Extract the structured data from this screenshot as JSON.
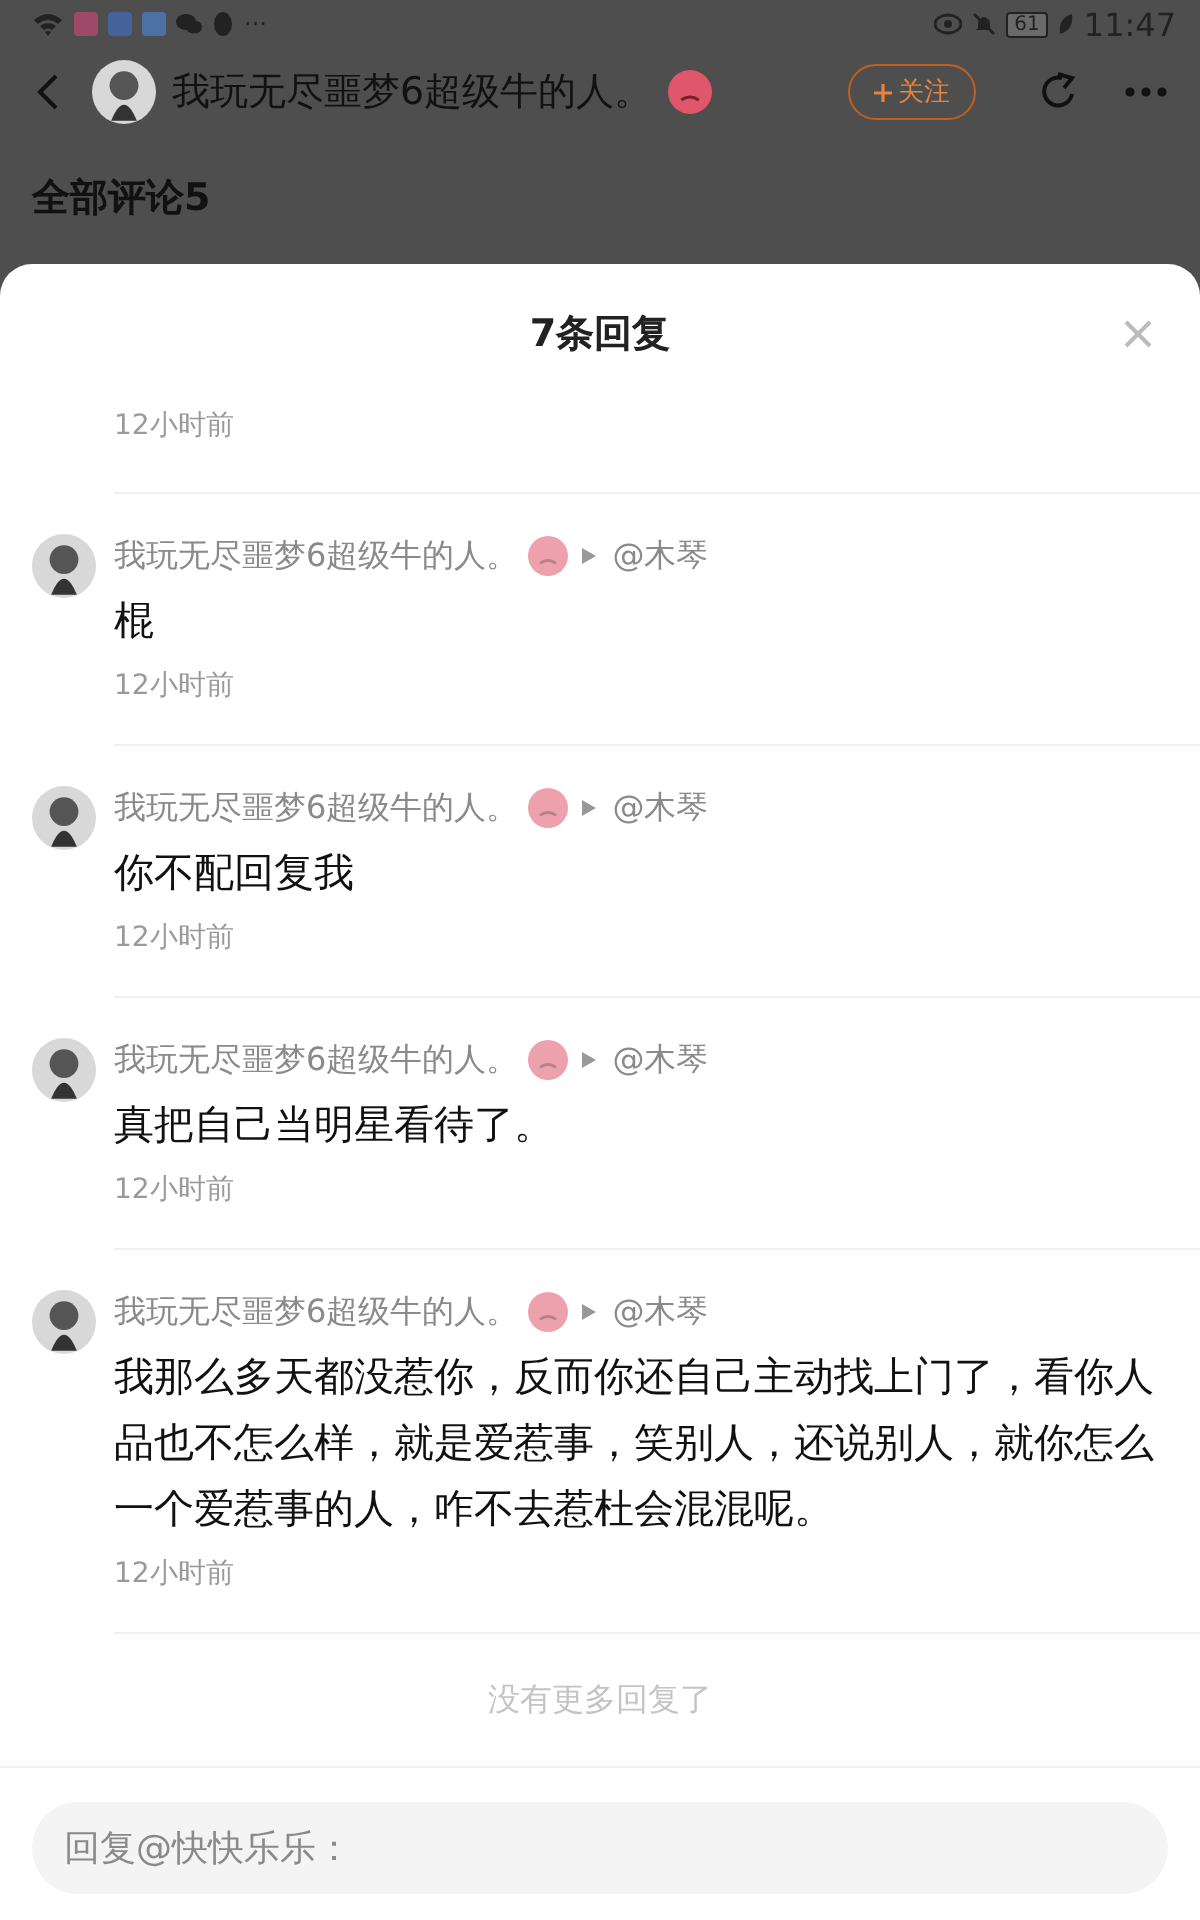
{
  "status_bar": {
    "overflow": "···",
    "battery": "61",
    "time": "11:47"
  },
  "header": {
    "title": "我玩无尽噩梦6超级牛的人。",
    "follow_button": "关注"
  },
  "section_title": "全部评论5",
  "sheet": {
    "title": "7条回复",
    "top_time": "12小时前",
    "replies": [
      {
        "author": "我玩无尽噩梦6超级牛的人。",
        "reply_to": "@木琴",
        "text": "棍",
        "time": "12小时前"
      },
      {
        "author": "我玩无尽噩梦6超级牛的人。",
        "reply_to": "@木琴",
        "text": "你不配回复我",
        "time": "12小时前"
      },
      {
        "author": "我玩无尽噩梦6超级牛的人。",
        "reply_to": "@木琴",
        "text": "真把自己当明星看待了。",
        "time": "12小时前"
      },
      {
        "author": "我玩无尽噩梦6超级牛的人。",
        "reply_to": "@木琴",
        "text": "我那么多天都没惹你，反而你还自己主动找上门了，看你人品也不怎么样，就是爱惹事，笑别人，还说别人，就你怎么一个爱惹事的人，咋不去惹杜会混混呢。",
        "time": "12小时前"
      }
    ],
    "end_note": "没有更多回复了",
    "reply_field": {
      "placeholder": "回复@快快乐乐："
    }
  }
}
